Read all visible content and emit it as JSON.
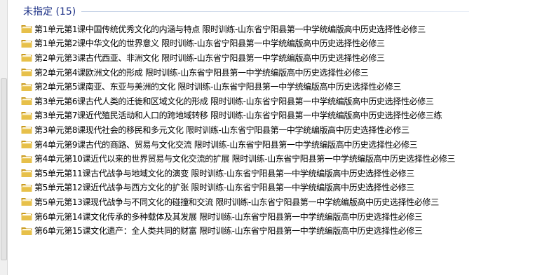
{
  "group": {
    "label": "未指定",
    "count": "(15)",
    "title": "未指定 (15)"
  },
  "icons": {
    "folder": "folder-icon"
  },
  "colors": {
    "group_title": "#1e3287",
    "folder_body": "#e7c04a",
    "folder_dark": "#c99a1c"
  },
  "files": [
    "第1单元第1课中国传统优秀文化的内涵与特点 限时训练-山东省宁阳县第一中学统编版高中历史选择性必修三",
    "第1单元第2课中华文化的世界意义 限时训练-山东省宁阳县第一中学统编版高中历史选择性必修三",
    "第2单元第3课古代西亚、非洲文化 限时训练-山东省宁阳县第一中学统编版高中历史选择性必修三",
    "第2单元第4课欧洲文化的形成 限时训练-山东省宁阳县第一中学统编版高中历史选择性必修三",
    "第2单元第5课南亚、东亚与美洲的文化 限时训练-山东省宁阳县第一中学统编版高中历史选择性必修三",
    "第3单元第6课古代人类的迁徙和区域文化的形成 限时训练-山东省宁阳县第一中学统编版高中历史选择性必修三",
    "第3单元第7课近代殖民活动和人口的跨地域转移 限时训练-山东省宁阳县第一中学统编版高中历史选择性必修三练",
    "第3单元第8课现代社会的移民和多元文化 限时训练-山东省宁阳县第一中学统编版高中历史选择性必修三",
    "第4单元第9课古代的商路、贸易与文化交流 限时训练-山东省宁阳县第一中学统编版高中历史选择性必修三",
    "第4单元第10课近代以来的世界贸易与文化交流的扩展 限时训练-山东省宁阳县第一中学统编版高中历史选择性必修三",
    "第5单元第11课古代战争与地域文化的演变 限时训练-山东省宁阳县第一中学统编版高中历史选择性必修三",
    "第5单元第12课近代战争与西方文化的扩张 限时训练-山东省宁阳县第一中学统编版高中历史选择性必修三",
    "第5单元第13课现代战争与不同文化的碰撞和交流 限时训练-山东省宁阳县第一中学统编版高中历史选择性必修三",
    "第6单元第14课文化传承的多种载体及其发展 限时训练-山东省宁阳县第一中学统编版高中历史选择性必修三",
    "第6单元第15课文化遗产：全人类共同的财富 限时训练-山东省宁阳县第一中学统编版高中历史选择性必修三"
  ]
}
